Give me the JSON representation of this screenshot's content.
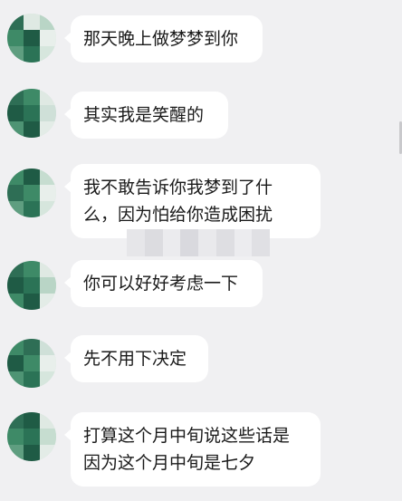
{
  "chat": {
    "messages": [
      {
        "text": "那天晚上做梦梦到你"
      },
      {
        "text": "其实我是笑醒的"
      },
      {
        "text": "我不敢告诉你我梦到了什\n么，因为怕给你造成困扰"
      },
      {
        "text": "你可以好好考虑一下"
      },
      {
        "text": "先不用下决定"
      },
      {
        "text": "打算这个月中旬说这些话是\n因为这个月中旬是七夕"
      }
    ]
  },
  "colors": {
    "background": "#f0f0f2",
    "bubble": "#ffffff",
    "text": "#1a1a1a",
    "avatar_green_dark": "#1f5b45",
    "avatar_green_mid": "#3e8a67",
    "avatar_green_light": "#8fc2a8"
  }
}
